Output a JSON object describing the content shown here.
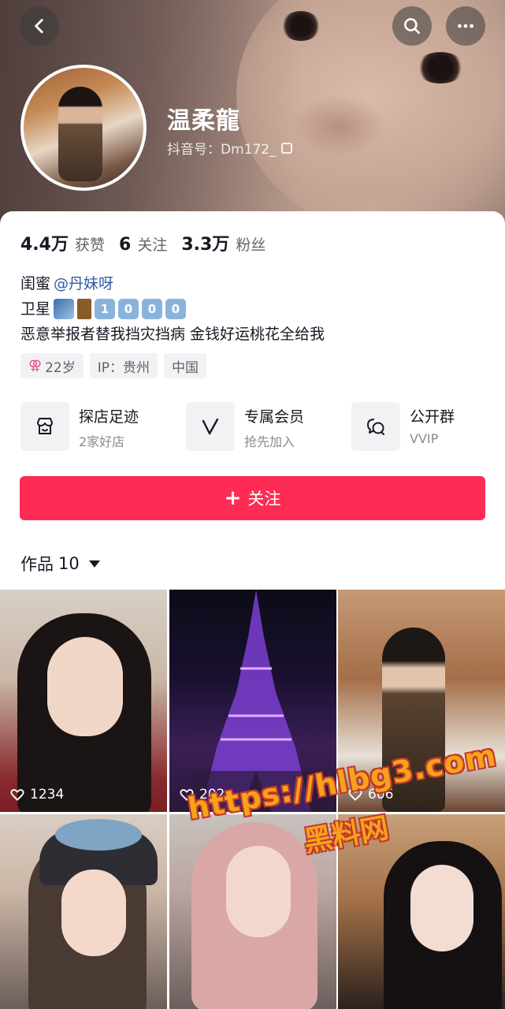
{
  "header": {
    "username": "温柔龍",
    "douyin_id": "抖音号：Dm172_",
    "back_icon": "back-arrow-icon",
    "search_icon": "search-icon",
    "more_icon": "more-dots-icon"
  },
  "stats": [
    {
      "num": "4.4万",
      "label": "获赞"
    },
    {
      "num": "6",
      "label": "关注"
    },
    {
      "num": "3.3万",
      "label": "粉丝"
    }
  ],
  "bio": {
    "line1_prefix": "闺蜜",
    "line1_mention": "@丹妹呀",
    "line2_prefix": "卫星",
    "line2_digits": [
      "1",
      "0",
      "0",
      "0"
    ],
    "line3": "恶意举报者替我挡灾挡病  金钱好运桃花全给我"
  },
  "tags": {
    "gender_symbol": "⚢",
    "age": "22岁",
    "ip": "IP：贵州",
    "country": "中国"
  },
  "services": [
    {
      "title": "探店足迹",
      "sub": "2家好店",
      "icon": "shop-icon"
    },
    {
      "title": "专属会员",
      "sub": "抢先加入",
      "icon": "vip-v-icon"
    },
    {
      "title": "公开群",
      "sub": "VVIP",
      "icon": "group-chat-icon"
    }
  ],
  "follow_button": {
    "plus": "+",
    "label": "关注"
  },
  "works": {
    "label": "作品",
    "count": "10"
  },
  "videos": [
    {
      "likes": "1234"
    },
    {
      "likes": "202"
    },
    {
      "likes": "606"
    },
    {
      "likes": ""
    },
    {
      "likes": ""
    },
    {
      "likes": ""
    }
  ],
  "watermark": {
    "url": "https://hlbg3.com",
    "name": "黑料网"
  },
  "colors": {
    "accent": "#fe2c55",
    "mention": "#2f5aa8"
  }
}
